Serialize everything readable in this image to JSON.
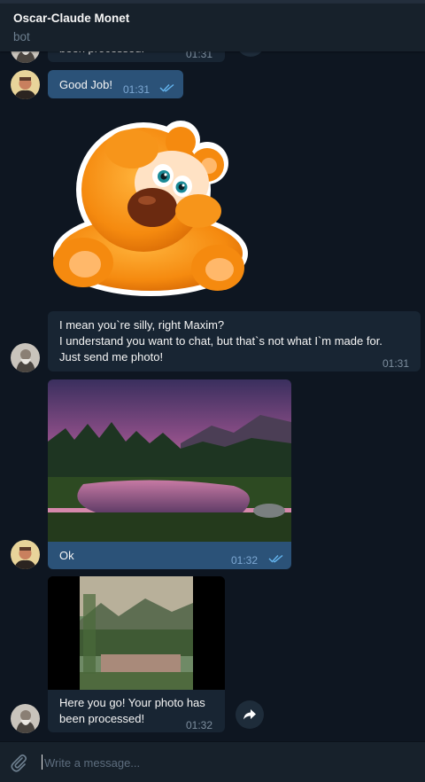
{
  "header": {
    "title": "Oscar-Claude Monet",
    "subtitle": "bot"
  },
  "messages": [
    {
      "id": "m0",
      "partial_text": "been processed.",
      "time": "01:31"
    },
    {
      "id": "m1",
      "text": "Good Job!",
      "time": "01:31",
      "outgoing": true,
      "read": true
    },
    {
      "id": "m2",
      "type": "sticker",
      "sticker": "orange-bear-sticker"
    },
    {
      "id": "m3",
      "lines": [
        "I mean you`re silly, right Maxim?",
        "I understand you want to chat, but that`s not what I`m made for.",
        "Just send me photo!"
      ],
      "time": "01:31"
    },
    {
      "id": "m4",
      "caption": "Ok",
      "time": "01:32",
      "outgoing": true,
      "read": true
    },
    {
      "id": "m5",
      "lines": [
        "Here you go! Your photo has",
        "been processed!"
      ],
      "time": "01:32"
    }
  ],
  "composer": {
    "placeholder": "Write a message..."
  },
  "colors": {
    "background": "#0e1621",
    "header": "#17212b",
    "outgoing_bubble": "#2b5278",
    "incoming_bubble": "#182533",
    "read_check": "#64b5ef"
  },
  "icons": [
    "paperclip-icon",
    "share-arrow-icon",
    "double-check-icon"
  ]
}
